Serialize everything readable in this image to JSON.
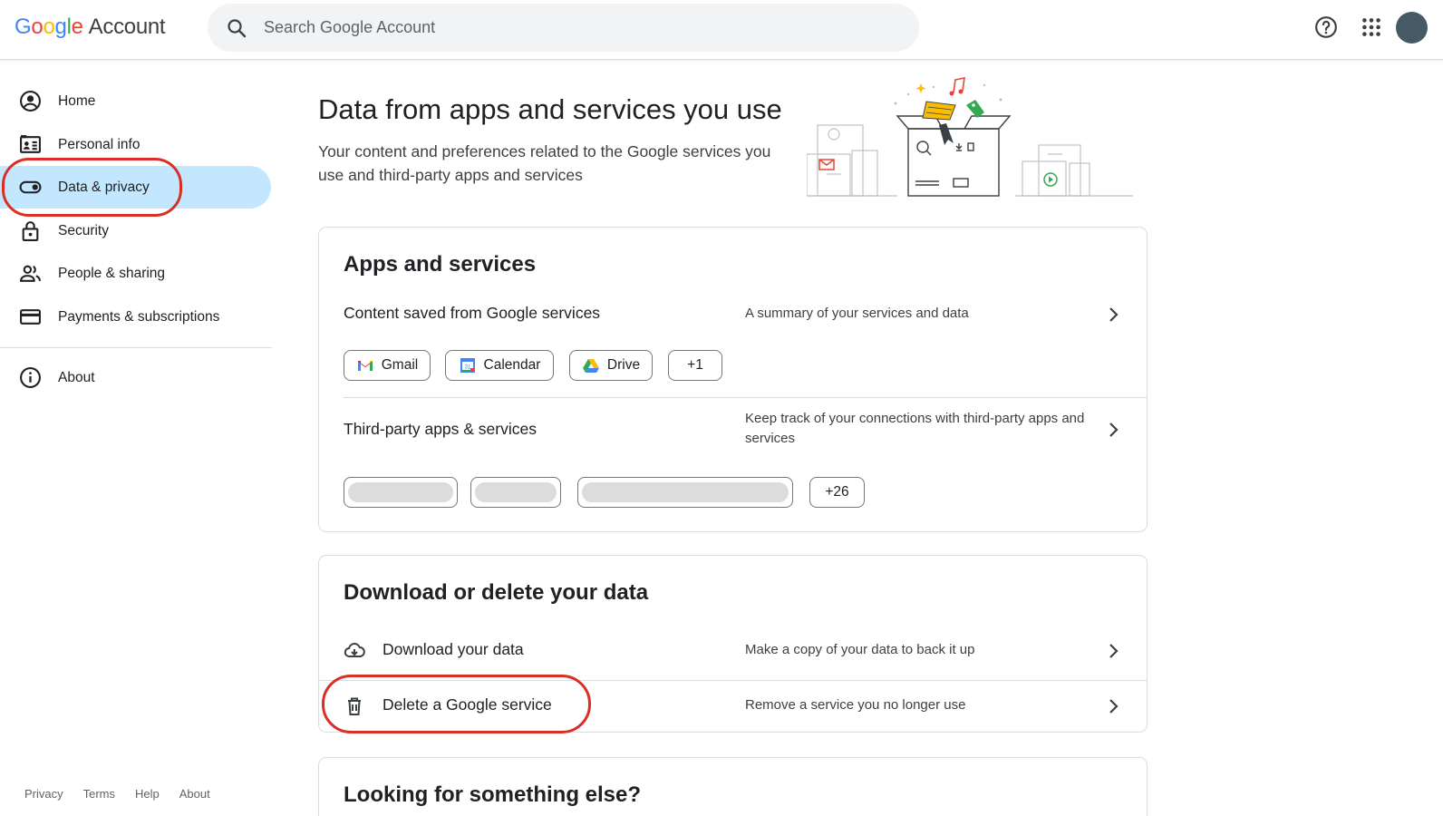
{
  "header": {
    "logo_letters": [
      "G",
      "o",
      "o",
      "g",
      "l",
      "e"
    ],
    "logo_suffix": "Account",
    "search_placeholder": "Search Google Account",
    "help_icon": "help-circle-icon",
    "apps_icon": "apps-grid-icon"
  },
  "sidebar": {
    "items": [
      {
        "label": "Home",
        "icon": "account-circle-icon"
      },
      {
        "label": "Personal info",
        "icon": "id-card-icon"
      },
      {
        "label": "Data & privacy",
        "icon": "toggle-icon",
        "active": true
      },
      {
        "label": "Security",
        "icon": "lock-icon"
      },
      {
        "label": "People & sharing",
        "icon": "people-icon"
      },
      {
        "label": "Payments & subscriptions",
        "icon": "credit-card-icon"
      },
      {
        "label": "About",
        "icon": "info-icon"
      }
    ]
  },
  "footer": {
    "links": [
      "Privacy",
      "Terms",
      "Help",
      "About"
    ]
  },
  "main": {
    "title": "Data from apps and services you use",
    "subtitle": "Your content and preferences related to the Google services you use and third-party apps and services",
    "apps_card": {
      "title": "Apps and services",
      "content_row": {
        "label": "Content saved from Google services",
        "desc": "A summary of your services and data"
      },
      "chips": [
        "Gmail",
        "Calendar",
        "Drive",
        "+1"
      ],
      "third_party_row": {
        "label": "Third-party apps & services",
        "desc": "Keep track of your connections with third-party apps and services"
      },
      "third_party_more": "+26"
    },
    "download_card": {
      "title": "Download or delete your data",
      "download_row": {
        "label": "Download your data",
        "desc": "Make a copy of your data to back it up"
      },
      "delete_row": {
        "label": "Delete a Google service",
        "desc": "Remove a service you no longer use"
      }
    },
    "more_card": {
      "title": "Looking for something else?"
    }
  },
  "colors": {
    "active_nav": "#c2e7ff",
    "highlight_annotation": "#d93025"
  }
}
